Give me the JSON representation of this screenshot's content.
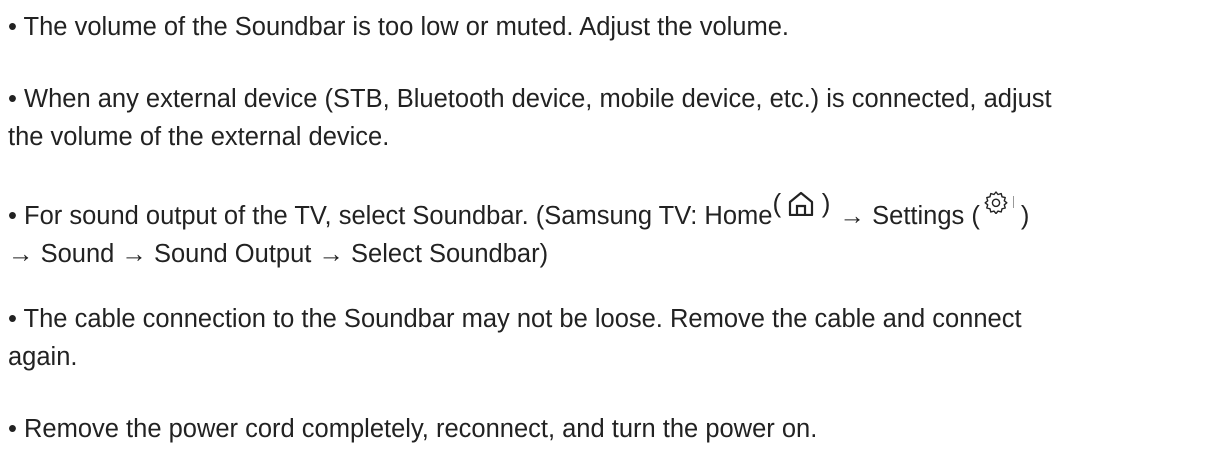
{
  "tips": [
    {
      "text": "• The volume of the Soundbar is too low or muted. Adjust the volume."
    },
    {
      "line1": "• When any external device (STB, Bluetooth device, mobile device, etc.) is connected, adjust",
      "line2": "the volume of the external device."
    },
    {
      "line1_prefix": "• For sound output of the TV, select Soundbar. (Samsung TV: Home",
      "home_paren_open": "(",
      "home_paren_close": ")",
      "home_icon": "home-icon",
      "line1_mid": " → Settings (",
      "settings_icon": "gear-icon",
      "line1_suffix": " )",
      "line2": "→ Sound → Sound Output → Select Soundbar)"
    },
    {
      "line1": "• The cable connection to the Soundbar may not be loose. Remove the cable and connect",
      "line2": "again."
    },
    {
      "text": "• Remove the power cord completely, reconnect, and turn the power on."
    }
  ]
}
